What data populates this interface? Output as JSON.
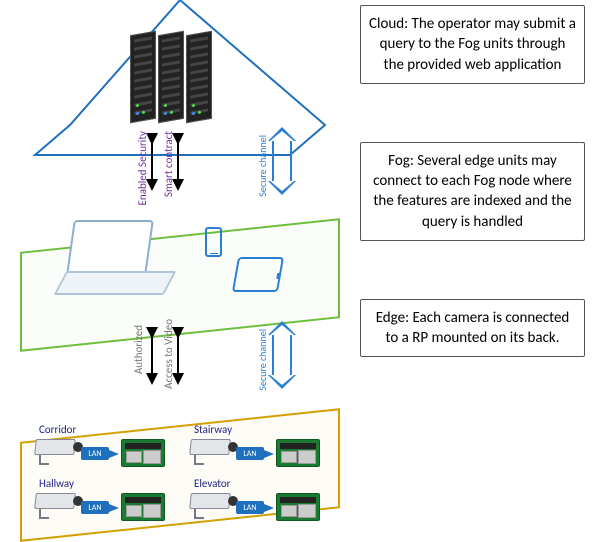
{
  "tiers": {
    "cloud": "Cloud: The operator may submit a query to the Fog units through the provided web application",
    "fog": "Fog: Several edge units may connect to each Fog node where the features are indexed and the query is handled",
    "edge": "Edge: Each camera is connected to a RP mounted on its back."
  },
  "labels": {
    "enabled_security": "Enabled Security",
    "smart_contract": "Smart contract",
    "authorized": "Authorized",
    "access_to_video": "Access to Video",
    "secure_channel": "Secure channel",
    "lan": "LAN"
  },
  "cameras": [
    {
      "name": "Corridor"
    },
    {
      "name": "Stairway"
    },
    {
      "name": "Hallway"
    },
    {
      "name": "Elevator"
    }
  ]
}
